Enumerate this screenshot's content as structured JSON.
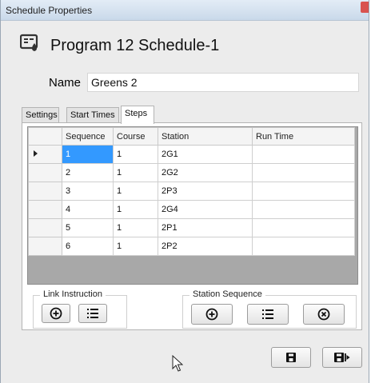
{
  "window": {
    "title": "Schedule Properties"
  },
  "header": {
    "title": "Program 12 Schedule-1"
  },
  "name_field": {
    "label": "Name",
    "value": "Greens 2"
  },
  "tabs": [
    {
      "label": "Settings"
    },
    {
      "label": "Start Times"
    },
    {
      "label": "Steps"
    }
  ],
  "grid": {
    "columns": [
      "Sequence",
      "Course",
      "Station",
      "Run Time"
    ],
    "rows": [
      [
        "1",
        "1",
        "2G1",
        ""
      ],
      [
        "2",
        "1",
        "2G2",
        ""
      ],
      [
        "3",
        "1",
        "2P3",
        ""
      ],
      [
        "4",
        "1",
        "2G4",
        ""
      ],
      [
        "5",
        "1",
        "2P1",
        ""
      ],
      [
        "6",
        "1",
        "2P2",
        ""
      ]
    ]
  },
  "link_instruction": {
    "label": "Link Instruction"
  },
  "station_sequence": {
    "label": "Station Sequence"
  },
  "icons": {
    "add": "add-circle-icon",
    "list": "list-icon",
    "remove": "remove-circle-icon",
    "save": "save-icon",
    "save_close": "save-exit-icon",
    "program": "schedule-program-icon",
    "cursor": "mouse-cursor-icon"
  },
  "colors": {
    "selection": "#3399ff",
    "grid_background": "#a8a8a8"
  }
}
